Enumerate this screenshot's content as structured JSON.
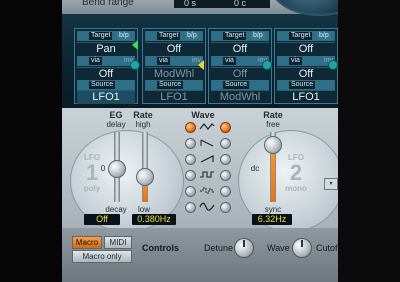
{
  "top": {
    "bend_range_label": "Bend range",
    "bend_range_down": "0 s",
    "bend_range_up": "0 c"
  },
  "router": {
    "slots": [
      {
        "target_label": "Target",
        "bp": "b/p",
        "target": "Pan",
        "via_label": "via",
        "inv": "inv",
        "via": "Off",
        "source_label": "Source",
        "source": "LFO1"
      },
      {
        "target_label": "Target",
        "bp": "b/p",
        "target": "Off",
        "via_label": "via",
        "inv": "inv",
        "via": "ModWhl",
        "source_label": "Source",
        "source": "LFO1"
      },
      {
        "target_label": "Target",
        "bp": "b/p",
        "target": "Off",
        "via_label": "via",
        "inv": "inv",
        "via": "Off",
        "source_label": "Source",
        "source": "ModWhl"
      },
      {
        "target_label": "Target",
        "bp": "b/p",
        "target": "Off",
        "via_label": "via",
        "inv": "inv",
        "via": "Off",
        "source_label": "Source",
        "source": "LFO1"
      }
    ]
  },
  "lfo1": {
    "eg_label": "EG",
    "eg_sub": "delay",
    "decay_label": "decay",
    "rate_label": "Rate",
    "rate_high": "high",
    "rate_low": "low",
    "zero": "0",
    "ghost_lfo": "LFO",
    "ghost_num": "1",
    "ghost_poly": "poly",
    "eg_value": "Off",
    "rate_value": "0.380Hz"
  },
  "wave": {
    "label": "Wave",
    "selected_left": 0,
    "selected_right": 0
  },
  "lfo2": {
    "rate_label": "Rate",
    "free": "free",
    "sync": "sync",
    "dc": "dc",
    "ghost_lfo": "LFO",
    "ghost_num": "2",
    "ghost_mono": "mono",
    "rate_value": "6.32Hz"
  },
  "bottom": {
    "macro": "Macro",
    "midi": "MIDI",
    "macro_only": "Macro only",
    "controls": "Controls",
    "detune": "Detune",
    "wave": "Wave",
    "cutoff": "Cutof"
  },
  "colors": {
    "orange": "#f07010",
    "lcd_text": "#ffde2e",
    "router_bg": "#0c2431"
  }
}
